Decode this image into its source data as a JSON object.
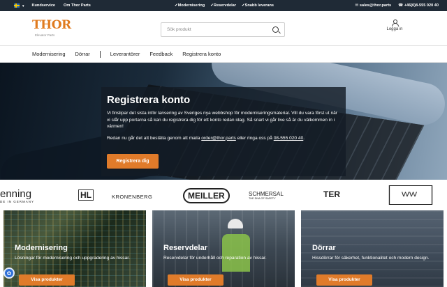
{
  "topbar": {
    "language": "SE",
    "links": [
      "Kundservice",
      "Om Thor Parts"
    ],
    "usps": [
      "Modernisering",
      "Reservdelar",
      "Snabb leverans"
    ],
    "email": "sales@thor.parts",
    "phone": "+46(0)8-555 020 40"
  },
  "header": {
    "logo_text": "THOR",
    "logo_sub": "Elevator Parts",
    "search_placeholder": "Sök produkt",
    "login_label": "Logga in"
  },
  "nav": {
    "items": [
      "Modernisering",
      "Dörrar",
      "Leverantörer",
      "Feedback",
      "Registrera konto"
    ]
  },
  "hero": {
    "title": "Registrera konto",
    "text": "Vi finslipar det sista inför lansering av Sveriges nya webbshop för moderniseringsmaterial. Vill du vara först ut när vi slår upp portarna så kan du registrera dig för ett konto redan idag. Så snart vi går live så är du välkommen in i värmen!",
    "text2_prefix": "Redan nu går det att beställa genom att maila ",
    "text2_email": "order@thor.parts",
    "text2_middle": " eller ringa oss på ",
    "text2_phone": "08-555 020 40",
    "text2_suffix": ".",
    "button": "Registrera dig"
  },
  "brands": [
    "enning",
    "HL",
    "KRONENBERG",
    "MEILLER",
    "SCHMERSAL",
    "TER",
    "WW"
  ],
  "brand_subs": {
    "enning": "DE IN GERMANY",
    "SCHMERSAL": "THE DNA OF SAFETY"
  },
  "cards": [
    {
      "title": "Modernisering",
      "desc": "Lösningar för modernisering och uppgradering av hissar.",
      "button": "Visa produkter"
    },
    {
      "title": "Reservdelar",
      "desc": "Reservdelar för underhåll och reparation av hissar.",
      "button": "Visa produkter"
    },
    {
      "title": "Dörrar",
      "desc": "Hissdörrar för säkerhet, funktionalitet och modern design.",
      "button": "Visa produkter"
    }
  ],
  "colors": {
    "accent": "#e07b2a",
    "topbar": "#1f2a36"
  }
}
